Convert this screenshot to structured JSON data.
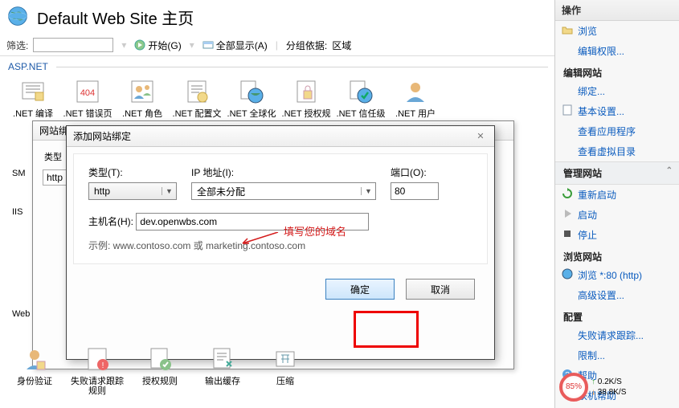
{
  "title": "Default Web Site 主页",
  "toolbar": {
    "filter_label": "筛选:",
    "start_label": "开始(G)",
    "show_all_label": "全部显示(A)",
    "group_by_label": "分组依据:",
    "group_by_value": "区域"
  },
  "section_aspnet": "ASP.NET",
  "aspnet_icons": [
    ".NET 编译",
    ".NET 错误页",
    ".NET 角色",
    ".NET 配置文",
    ".NET 全球化",
    ".NET 授权规",
    ".NET 信任级",
    ".NET 用户"
  ],
  "under_dialog_title": "网站绑",
  "under_label_type": "类型",
  "under_val_type": "http",
  "sm_label": "SM",
  "iis_label": "IIS",
  "web_label": "Web",
  "dialog": {
    "title": "添加网站绑定",
    "type_label": "类型(T):",
    "type_value": "http",
    "ip_label": "IP 地址(I):",
    "ip_value": "全部未分配",
    "port_label": "端口(O):",
    "port_value": "80",
    "host_label": "主机名(H):",
    "host_value": "dev.openwbs.com",
    "annotation": "填写您的域名",
    "example": "示例: www.contoso.com 或 marketing.contoso.com",
    "ok": "确定",
    "cancel": "取消"
  },
  "bottom_icons": [
    "身份验证",
    "失败请求跟踪规则",
    "授权规则",
    "输出缓存",
    "压缩"
  ],
  "sidebar": {
    "header": "操作",
    "browse": "浏览",
    "edit_perm": "编辑权限...",
    "grp_edit": "编辑网站",
    "binding": "绑定...",
    "basic": "基本设置...",
    "view_app": "查看应用程序",
    "view_vdir": "查看虚拟目录",
    "grp_manage": "管理网站",
    "restart": "重新启动",
    "start": "启动",
    "stop": "停止",
    "grp_browse": "浏览网站",
    "browse80": "浏览 *:80 (http)",
    "advanced": "高级设置...",
    "grp_config": "配置",
    "failed": "失败请求跟踪...",
    "limits": "限制...",
    "help": "帮助",
    "online_help": "联机帮助"
  },
  "gauge": {
    "pct": "85%",
    "up": "0.2K/S",
    "down": "38.8K/S"
  }
}
